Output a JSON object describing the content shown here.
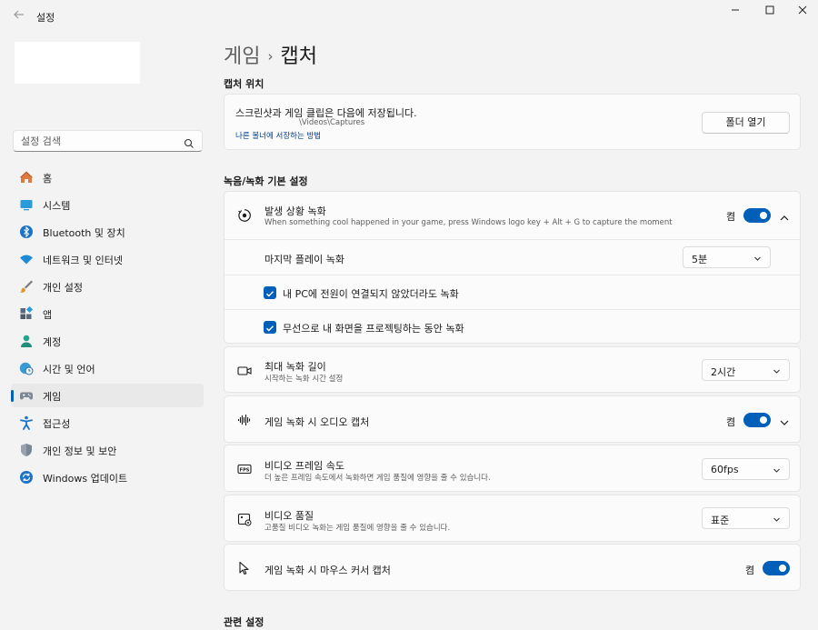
{
  "window": {
    "title": "설정"
  },
  "sidebar": {
    "search_placeholder": "설정 검색",
    "items": [
      {
        "label": "홈",
        "icon": "home-icon",
        "active": false
      },
      {
        "label": "시스템",
        "icon": "system-icon",
        "active": false
      },
      {
        "label": "Bluetooth 및 장치",
        "icon": "bluetooth-icon",
        "active": false
      },
      {
        "label": "네트워크 및 인터넷",
        "icon": "wifi-icon",
        "active": false
      },
      {
        "label": "개인 설정",
        "icon": "brush-icon",
        "active": false
      },
      {
        "label": "앱",
        "icon": "apps-icon",
        "active": false
      },
      {
        "label": "계정",
        "icon": "account-icon",
        "active": false
      },
      {
        "label": "시간 및 언어",
        "icon": "clock-globe-icon",
        "active": false
      },
      {
        "label": "게임",
        "icon": "gamepad-icon",
        "active": true
      },
      {
        "label": "접근성",
        "icon": "accessibility-icon",
        "active": false
      },
      {
        "label": "개인 정보 및 보안",
        "icon": "shield-icon",
        "active": false
      },
      {
        "label": "Windows 업데이트",
        "icon": "update-icon",
        "active": false
      }
    ]
  },
  "breadcrumb": {
    "parent": "게임",
    "separator": "›",
    "current": "캡처"
  },
  "capture_location": {
    "section_title": "캡처 위치",
    "description": "스크린샷과 게임 클립은 다음에 저장됩니다.",
    "path": "\\Videos\\Captures",
    "link": "나른 볼너에 서장하는 방법",
    "open_folder_button": "폴더 열기"
  },
  "recording": {
    "section_title": "녹음/녹화 기본 설정",
    "background": {
      "title": "발생 상황 녹화",
      "description": "When something cool happened in your game, press Windows logo key + Alt + G to capture the moment",
      "toggle_label": "켬",
      "toggle_on": true,
      "last_play_label": "마지막 플레이 녹화",
      "last_play_value": "5분",
      "checkbox_power": "내 PC에 전원이 연결되지 않았더라도 녹화",
      "checkbox_wireless": "무선으로 내 화면을 프로젝팅하는 동안 녹화"
    },
    "max_length": {
      "title": "최대 녹화 길이",
      "description": "시작하는 녹화 시간 설정",
      "value": "2시간"
    },
    "audio": {
      "title": "게임 녹화 시 오디오 캡처",
      "toggle_label": "켬",
      "toggle_on": true
    },
    "frame_rate": {
      "title": "비디오 프레임 속도",
      "description": "더 높은 프레임 속도에서 녹화하면 게임 품질에 영향을 줄 수 있습니다.",
      "value": "60fps"
    },
    "quality": {
      "title": "비디오 품질",
      "description": "고품질 비디오 녹화는 게임 품질에 영향을 줄 수 있습니다.",
      "value": "표준"
    },
    "cursor": {
      "title": "게임 녹화 시 마우스 커서 캡처",
      "toggle_label": "켬",
      "toggle_on": true
    }
  },
  "related": {
    "section_title": "관련 설정"
  },
  "colors": {
    "accent": "#005fb8",
    "background": "#f3f3f3",
    "card": "#fbfbfb"
  }
}
